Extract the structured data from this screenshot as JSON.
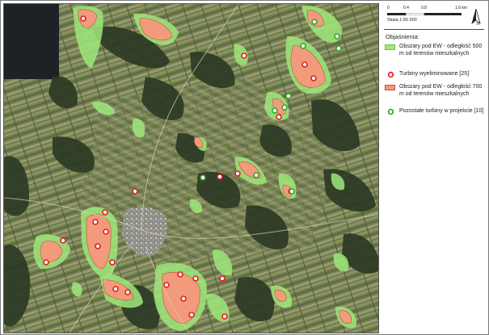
{
  "scale": {
    "ticks": [
      "0",
      "0.4",
      "0.8",
      "1.6 km"
    ],
    "ratio": "Skala 1:55 000"
  },
  "north": "N",
  "legend": {
    "title": "Objaśnienia:",
    "items": [
      {
        "kind": "area",
        "label": "Obszary pod EW - odległość 500 m od terenów mieszkalnych",
        "color": "#9fe87b"
      },
      {
        "kind": "symbol",
        "label": "Turbiny wyeliminowane [25]",
        "color": "#e31a1c"
      },
      {
        "kind": "area",
        "label": "Obszary pod EW - odległość 700 m od terenów mieszkalnych",
        "color": "#f29b7c"
      },
      {
        "kind": "symbol",
        "label": "Pozostałe turbiny w projekcie [10]",
        "color": "#33a02c"
      }
    ]
  },
  "colors": {
    "zone500": "#9fe87b",
    "zone700": "#f29b7c",
    "turbine_eliminated": "#e31a1c",
    "turbine_remaining": "#33a02c"
  }
}
